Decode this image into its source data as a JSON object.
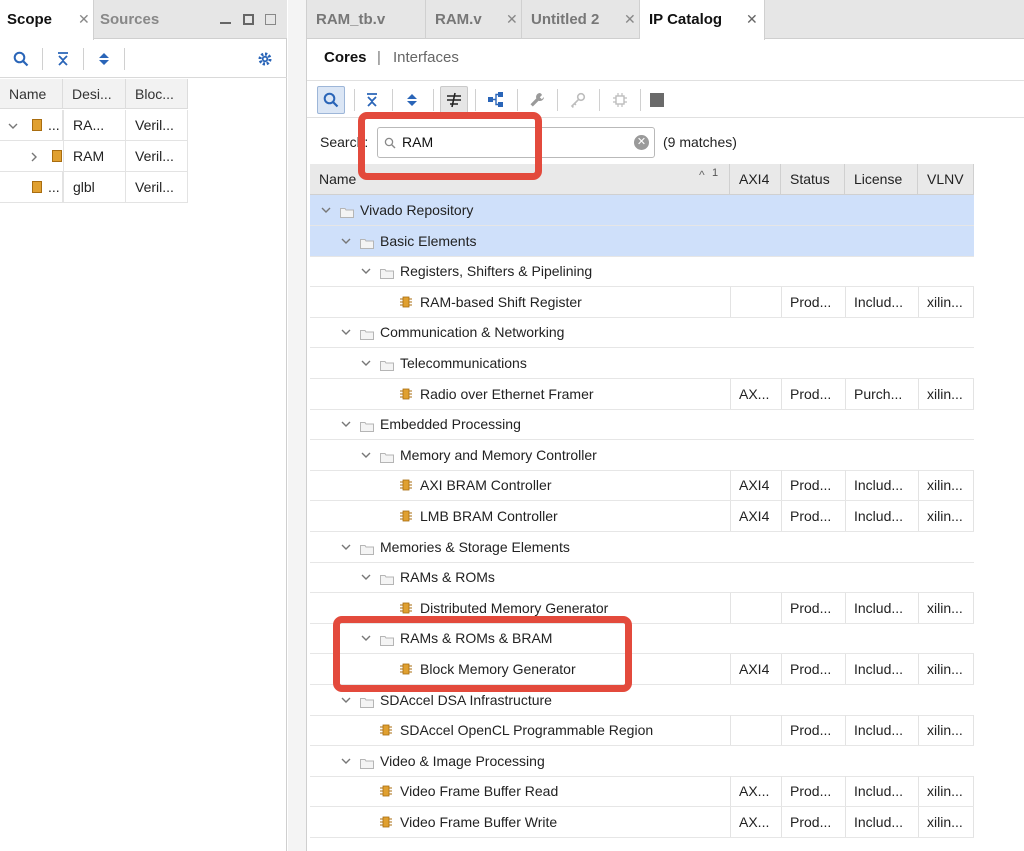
{
  "left": {
    "tabs": [
      {
        "label": "Scope"
      },
      {
        "label": "Sources"
      }
    ],
    "columns": [
      "Name",
      "Desi...",
      "Bloc..."
    ],
    "rows": [
      {
        "name": "...",
        "design": "RA...",
        "block": "Veril..."
      },
      {
        "name": "RAM",
        "design": "Veril...",
        "block": ""
      },
      {
        "name": "...",
        "design": "glbl",
        "block": "Veril..."
      }
    ]
  },
  "right": {
    "tabs": [
      {
        "label": "RAM_tb.v"
      },
      {
        "label": "RAM.v"
      },
      {
        "label": "Untitled 2"
      },
      {
        "label": "IP Catalog"
      }
    ],
    "subtabs": {
      "cores": "Cores",
      "sep": "|",
      "interfaces": "Interfaces"
    },
    "search": {
      "label": "Search:",
      "value": "RAM",
      "matches": "(9 matches)"
    },
    "columns": {
      "name": "Name",
      "sort": "1",
      "axi4": "AXI4",
      "status": "Status",
      "license": "License",
      "vlnv": "VLNV"
    },
    "rows": [
      {
        "level": 0,
        "kind": "folder",
        "name": "Vivado Repository",
        "selected": true
      },
      {
        "level": 1,
        "kind": "folder",
        "name": "Basic Elements",
        "selected": true
      },
      {
        "level": 2,
        "kind": "folder",
        "name": "Registers, Shifters & Pipelining"
      },
      {
        "level": 3,
        "kind": "ip",
        "name": "RAM-based Shift Register",
        "axi4": "",
        "status": "Prod...",
        "license": "Includ...",
        "vlnv": "xilin..."
      },
      {
        "level": 1,
        "kind": "folder",
        "name": "Communication & Networking"
      },
      {
        "level": 2,
        "kind": "folder",
        "name": "Telecommunications"
      },
      {
        "level": 3,
        "kind": "ip",
        "name": "Radio over Ethernet Framer",
        "axi4": "AX...",
        "status": "Prod...",
        "license": "Purch...",
        "vlnv": "xilin..."
      },
      {
        "level": 1,
        "kind": "folder",
        "name": "Embedded Processing"
      },
      {
        "level": 2,
        "kind": "folder",
        "name": "Memory and Memory Controller"
      },
      {
        "level": 3,
        "kind": "ip",
        "name": "AXI BRAM Controller",
        "axi4": "AXI4",
        "status": "Prod...",
        "license": "Includ...",
        "vlnv": "xilin..."
      },
      {
        "level": 3,
        "kind": "ip",
        "name": "LMB BRAM Controller",
        "axi4": "AXI4",
        "status": "Prod...",
        "license": "Includ...",
        "vlnv": "xilin..."
      },
      {
        "level": 1,
        "kind": "folder",
        "name": "Memories & Storage Elements"
      },
      {
        "level": 2,
        "kind": "folder",
        "name": "RAMs & ROMs"
      },
      {
        "level": 3,
        "kind": "ip",
        "name": "Distributed Memory Generator",
        "axi4": "",
        "status": "Prod...",
        "license": "Includ...",
        "vlnv": "xilin..."
      },
      {
        "level": 2,
        "kind": "folder",
        "name": "RAMs & ROMs & BRAM"
      },
      {
        "level": 3,
        "kind": "ip",
        "name": "Block Memory Generator",
        "axi4": "AXI4",
        "status": "Prod...",
        "license": "Includ...",
        "vlnv": "xilin..."
      },
      {
        "level": 1,
        "kind": "folder",
        "name": "SDAccel DSA Infrastructure"
      },
      {
        "level": 2,
        "kind": "ip",
        "name": "SDAccel OpenCL Programmable Region",
        "axi4": "",
        "status": "Prod...",
        "license": "Includ...",
        "vlnv": "xilin..."
      },
      {
        "level": 1,
        "kind": "folder",
        "name": "Video & Image Processing"
      },
      {
        "level": 2,
        "kind": "ip",
        "name": "Video Frame Buffer Read",
        "axi4": "AX...",
        "status": "Prod...",
        "license": "Includ...",
        "vlnv": "xilin..."
      },
      {
        "level": 2,
        "kind": "ip",
        "name": "Video Frame Buffer Write",
        "axi4": "AX...",
        "status": "Prod...",
        "license": "Includ...",
        "vlnv": "xilin..."
      }
    ]
  },
  "colors": {
    "highlight": "#e34a3c",
    "selection": "#cfe0fa",
    "ip_icon": "#e0a030",
    "accent": "#2a65b8"
  }
}
